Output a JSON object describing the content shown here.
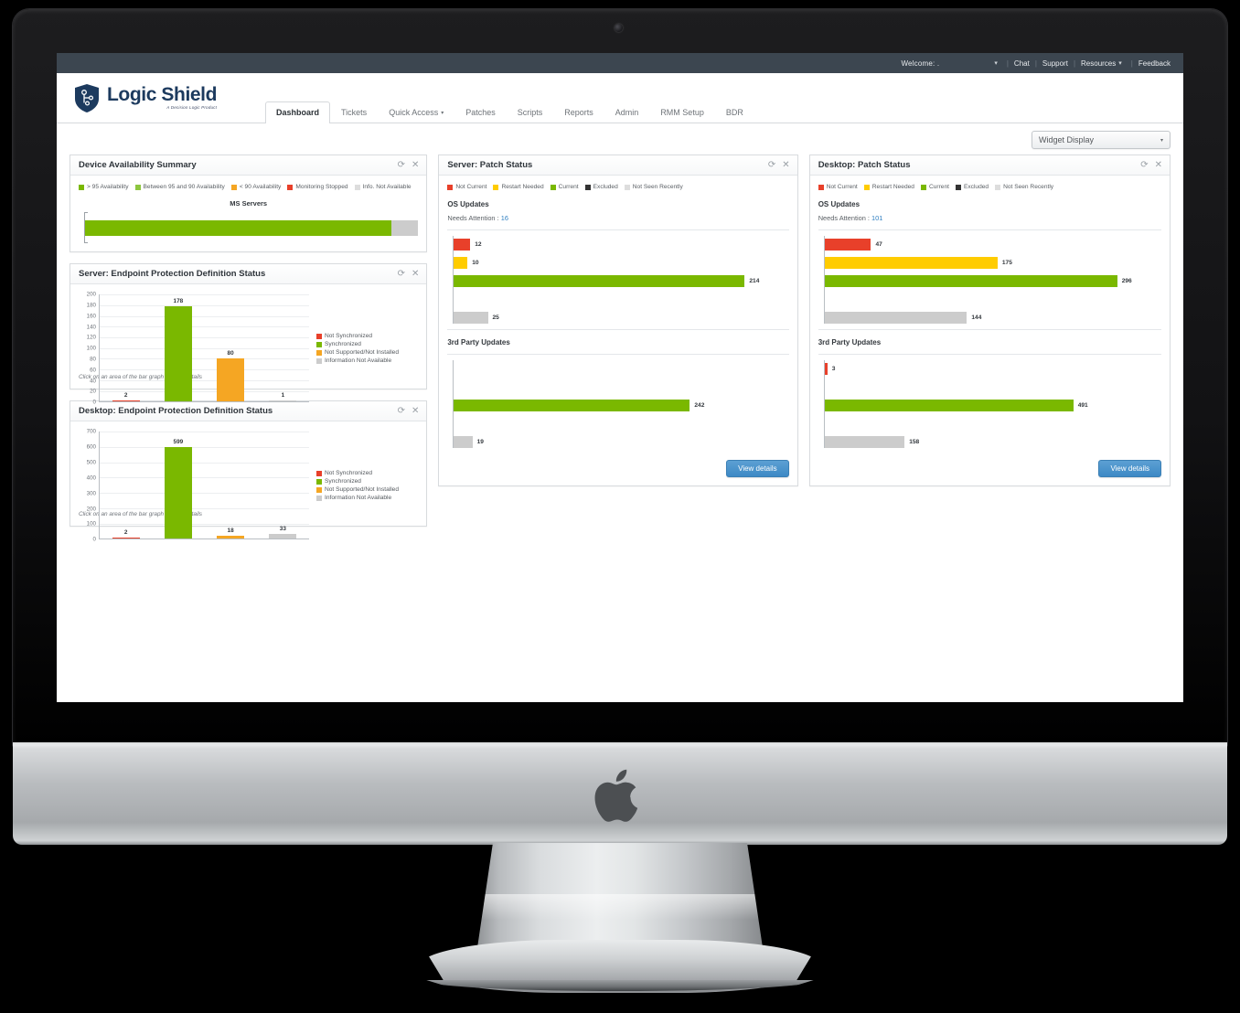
{
  "topbar": {
    "welcome": "Welcome: .",
    "caret": "▾",
    "links": [
      "Chat",
      "Support",
      "Resources",
      "Feedback"
    ],
    "resources_caret": "▾",
    "separator": "|"
  },
  "brand": {
    "name": "Logic Shield",
    "tagline": "A Decision Logic Product"
  },
  "nav": {
    "tabs": [
      {
        "label": "Dashboard",
        "active": true,
        "caret": ""
      },
      {
        "label": "Tickets",
        "active": false,
        "caret": ""
      },
      {
        "label": "Quick Access",
        "active": false,
        "caret": "▾"
      },
      {
        "label": "Patches",
        "active": false,
        "caret": ""
      },
      {
        "label": "Scripts",
        "active": false,
        "caret": ""
      },
      {
        "label": "Reports",
        "active": false,
        "caret": ""
      },
      {
        "label": "Admin",
        "active": false,
        "caret": ""
      },
      {
        "label": "RMM Setup",
        "active": false,
        "caret": ""
      },
      {
        "label": "BDR",
        "active": false,
        "caret": ""
      }
    ]
  },
  "toolbar": {
    "widget_display_label": "Widget Display",
    "caret": "▾"
  },
  "icons": {
    "refresh": "⟳",
    "close": "✕"
  },
  "colors": {
    "red": "#e8402a",
    "yellow": "#ffcc00",
    "green": "#7ab800",
    "orange": "#f5a623",
    "black": "#333333",
    "gray": "#cccccc",
    "light_gray": "#dddddd",
    "accent_blue": "#2f7fc1",
    "topbar_bg": "#3c4650",
    "brand_navy": "#1c3a5e"
  },
  "widgets": {
    "availability": {
      "title": "Device Availability Summary",
      "legend": [
        {
          "label": "> 95 Availability",
          "color": "#7ab800"
        },
        {
          "label": "Between 95 and 90 Availability",
          "color": "#8dc63f"
        },
        {
          "label": "< 90 Availability",
          "color": "#f5a623"
        },
        {
          "label": "Monitoring Stopped",
          "color": "#e8402a"
        },
        {
          "label": "Info. Not Available",
          "color": "#dddddd"
        }
      ],
      "chart_title": "MS Servers"
    },
    "server_endpoint": {
      "title": "Server: Endpoint Protection Definition Status",
      "hint": "Click on an area of the bar graph to view details"
    },
    "desktop_endpoint": {
      "title": "Desktop: Endpoint Protection Definition Status",
      "hint": "Click on an area of the bar graph to view details"
    },
    "server_patch": {
      "title": "Server: Patch Status",
      "os_section": "OS Updates",
      "needs_attention_label": "Needs Attention :",
      "needs_attention_value": "16",
      "third_party_section": "3rd Party Updates",
      "view_details": "View details"
    },
    "desktop_patch": {
      "title": "Desktop: Patch Status",
      "os_section": "OS Updates",
      "needs_attention_label": "Needs Attention :",
      "needs_attention_value": "101",
      "third_party_section": "3rd Party Updates",
      "view_details": "View details"
    },
    "patch_legend": [
      {
        "label": "Not Current",
        "color": "#e8402a"
      },
      {
        "label": "Restart Needed",
        "color": "#ffcc00"
      },
      {
        "label": "Current",
        "color": "#7ab800"
      },
      {
        "label": "Excluded",
        "color": "#333333"
      },
      {
        "label": "Not Seen Recently",
        "color": "#dddddd"
      }
    ],
    "endpoint_legend": [
      {
        "label": "Not Synchronized",
        "color": "#e8402a"
      },
      {
        "label": "Synchronized",
        "color": "#7ab800"
      },
      {
        "label": "Not Supported/Not Installed",
        "color": "#f5a623"
      },
      {
        "label": "Information Not Available",
        "color": "#cccccc"
      }
    ]
  },
  "chart_data": [
    {
      "id": "device_availability_summary",
      "type": "bar",
      "orientation": "horizontal-stacked",
      "title": "MS Servers",
      "categories": [
        "MS Servers"
      ],
      "series": [
        {
          "name": "> 95 Availability",
          "values": [
            92
          ],
          "color": "#7ab800"
        },
        {
          "name": "Between 95 and 90 Availability",
          "values": [
            0
          ],
          "color": "#8dc63f"
        },
        {
          "name": "< 90 Availability",
          "values": [
            0
          ],
          "color": "#f5a623"
        },
        {
          "name": "Monitoring Stopped",
          "values": [
            0
          ],
          "color": "#e8402a"
        },
        {
          "name": "Info. Not Available",
          "values": [
            8
          ],
          "color": "#cccccc"
        }
      ],
      "unit": "percent",
      "xlabel": "",
      "ylabel": "",
      "grid": false,
      "legend_position": "top"
    },
    {
      "id": "server_endpoint_protection",
      "type": "bar",
      "orientation": "vertical",
      "title": "Server: Endpoint Protection Definition Status",
      "categories": [
        "Not Synchronized",
        "Synchronized",
        "Not Supported/Not Installed",
        "Information Not Available"
      ],
      "values": [
        2,
        178,
        80,
        1
      ],
      "colors": [
        "#e8402a",
        "#7ab800",
        "#f5a623",
        "#cccccc"
      ],
      "ylim": [
        0,
        200
      ],
      "yticks": [
        0,
        20,
        40,
        60,
        80,
        100,
        120,
        140,
        160,
        180,
        200
      ],
      "xlabel": "",
      "ylabel": "",
      "grid": true,
      "legend_position": "right"
    },
    {
      "id": "desktop_endpoint_protection",
      "type": "bar",
      "orientation": "vertical",
      "title": "Desktop: Endpoint Protection Definition Status",
      "categories": [
        "Not Synchronized",
        "Synchronized",
        "Not Supported/Not Installed",
        "Information Not Available"
      ],
      "values": [
        2,
        599,
        18,
        33
      ],
      "colors": [
        "#e8402a",
        "#7ab800",
        "#f5a623",
        "#cccccc"
      ],
      "ylim": [
        0,
        700
      ],
      "yticks": [
        0,
        100,
        200,
        300,
        400,
        500,
        600,
        700
      ],
      "xlabel": "",
      "ylabel": "",
      "grid": true,
      "legend_position": "right"
    },
    {
      "id": "server_patch_os_updates",
      "type": "bar",
      "orientation": "horizontal",
      "title": "OS Updates",
      "categories": [
        "Not Current",
        "Restart Needed",
        "Current",
        "Excluded",
        "Not Seen Recently"
      ],
      "values": [
        12,
        10,
        214,
        0,
        25
      ],
      "colors": [
        "#e8402a",
        "#ffcc00",
        "#7ab800",
        "#333333",
        "#cccccc"
      ],
      "xlim": [
        0,
        214
      ],
      "grid": false,
      "legend_position": "top"
    },
    {
      "id": "server_patch_third_party",
      "type": "bar",
      "orientation": "horizontal",
      "title": "3rd Party Updates",
      "categories": [
        "Not Current",
        "Restart Needed",
        "Current",
        "Excluded",
        "Not Seen Recently"
      ],
      "values": [
        0,
        0,
        242,
        0,
        19
      ],
      "colors": [
        "#e8402a",
        "#ffcc00",
        "#7ab800",
        "#333333",
        "#cccccc"
      ],
      "xlim": [
        0,
        242
      ],
      "grid": false,
      "legend_position": "top"
    },
    {
      "id": "desktop_patch_os_updates",
      "type": "bar",
      "orientation": "horizontal",
      "title": "OS Updates",
      "categories": [
        "Not Current",
        "Restart Needed",
        "Current",
        "Excluded",
        "Not Seen Recently"
      ],
      "values": [
        47,
        175,
        296,
        0,
        144
      ],
      "colors": [
        "#e8402a",
        "#ffcc00",
        "#7ab800",
        "#333333",
        "#cccccc"
      ],
      "xlim": [
        0,
        296
      ],
      "grid": false,
      "legend_position": "top"
    },
    {
      "id": "desktop_patch_third_party",
      "type": "bar",
      "orientation": "horizontal",
      "title": "3rd Party Updates",
      "categories": [
        "Not Current",
        "Restart Needed",
        "Current",
        "Excluded",
        "Not Seen Recently"
      ],
      "values": [
        3,
        0,
        491,
        0,
        158
      ],
      "colors": [
        "#e8402a",
        "#ffcc00",
        "#7ab800",
        "#333333",
        "#cccccc"
      ],
      "xlim": [
        0,
        491
      ],
      "grid": false,
      "legend_position": "top"
    }
  ]
}
